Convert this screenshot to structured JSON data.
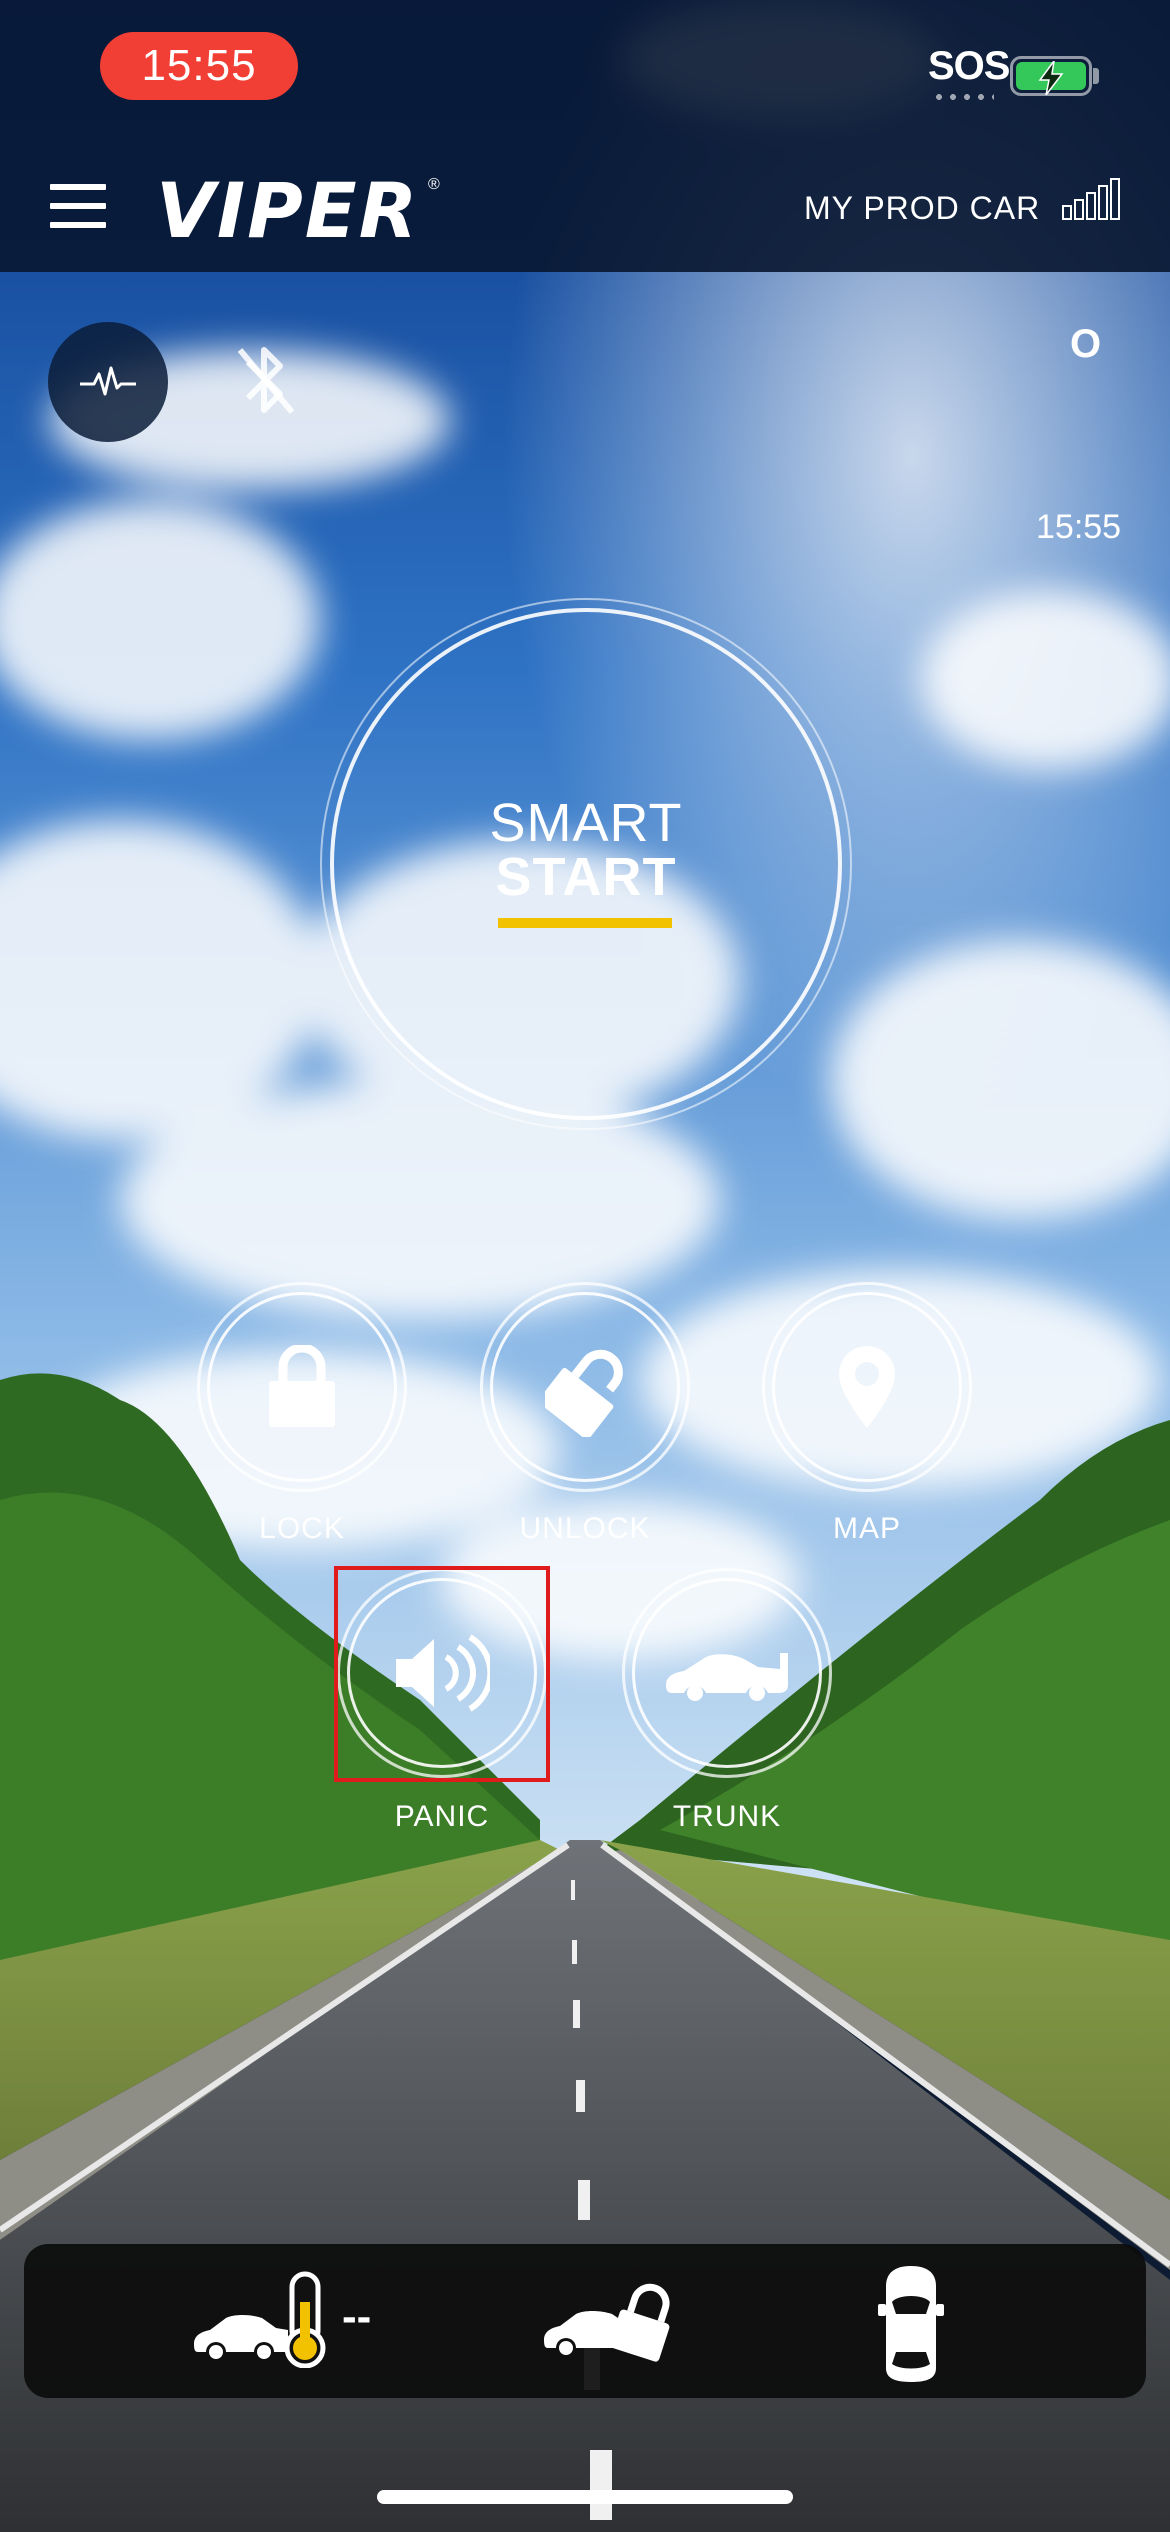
{
  "status_bar": {
    "time": "15:55",
    "sos": "SOS"
  },
  "header": {
    "logo": "VIPER",
    "car_name": "MY PROD CAR"
  },
  "top_row": {
    "right_label": "O",
    "clock": "15:55"
  },
  "smart_start": {
    "line1": "SMART",
    "line2": "START"
  },
  "actions": {
    "lock": "LOCK",
    "unlock": "UNLOCK",
    "map": "MAP",
    "panic": "PANIC",
    "trunk": "TRUNK"
  },
  "bottom_bar": {
    "temperature": "--"
  },
  "colors": {
    "accent_underline": "#f2c200",
    "status_pill": "#f23f35",
    "highlight": "#e01b1b",
    "battery": "#34c759"
  },
  "icons": [
    "menu-icon",
    "signal-icon",
    "activity-icon",
    "bluetooth-off-icon",
    "lock-icon",
    "unlock-icon",
    "map-pin-icon",
    "speaker-icon",
    "car-trunk-icon",
    "car-temperature-icon",
    "car-lock-icon",
    "car-top-view-icon"
  ]
}
